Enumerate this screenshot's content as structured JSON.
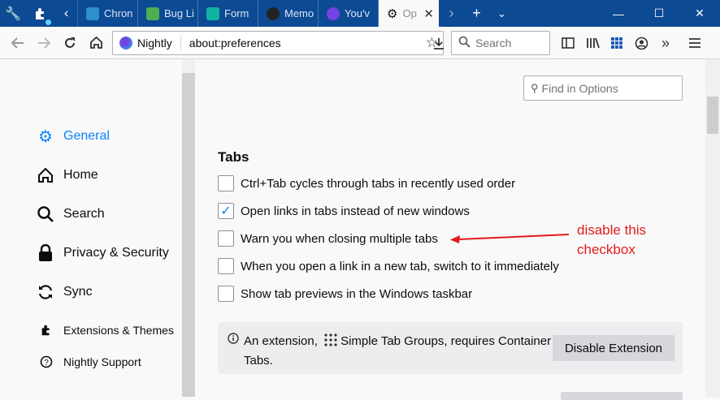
{
  "tabbar": {
    "tabs": [
      {
        "label": "Chron",
        "color": "#2f8fcf"
      },
      {
        "label": "Bug Li",
        "color": "#4caf50"
      },
      {
        "label": "Form",
        "color": "#10b3a3"
      },
      {
        "label": "Memo",
        "color": "#222222"
      },
      {
        "label": "You'v",
        "color": "#7542e5"
      }
    ],
    "active_tab": {
      "label": "Op"
    }
  },
  "navbar": {
    "brand": "Nightly",
    "address": "about:preferences",
    "search_placeholder": "Search"
  },
  "sidebar": {
    "items": [
      {
        "label": "General",
        "icon": "gear-icon",
        "selected": true
      },
      {
        "label": "Home",
        "icon": "home-icon"
      },
      {
        "label": "Search",
        "icon": "search-icon"
      },
      {
        "label": "Privacy & Security",
        "icon": "lock-icon"
      },
      {
        "label": "Sync",
        "icon": "sync-icon"
      }
    ],
    "footer": [
      {
        "label": "Extensions & Themes",
        "icon": "puzzle-icon"
      },
      {
        "label": "Nightly Support",
        "icon": "help-icon"
      }
    ]
  },
  "main": {
    "find_placeholder": "Find in Options",
    "section_title": "Tabs",
    "options": [
      {
        "label": "Ctrl+Tab cycles through tabs in recently used order",
        "checked": false
      },
      {
        "label": "Open links in tabs instead of new windows",
        "checked": true
      },
      {
        "label": "Warn you when closing multiple tabs",
        "checked": false
      },
      {
        "label": "When you open a link in a new tab, switch to it immediately",
        "checked": false
      },
      {
        "label": "Show tab previews in the Windows taskbar",
        "checked": false
      }
    ],
    "annotation": "disable this checkbox",
    "extension_notice": {
      "prefix": "An extension,",
      "name": "Simple Tab Groups, requires Container Tabs.",
      "button": "Disable Extension"
    }
  },
  "colors": {
    "titlebar": "#0c4a94",
    "accent": "#0a84ff",
    "annotation": "#e31b1b"
  }
}
